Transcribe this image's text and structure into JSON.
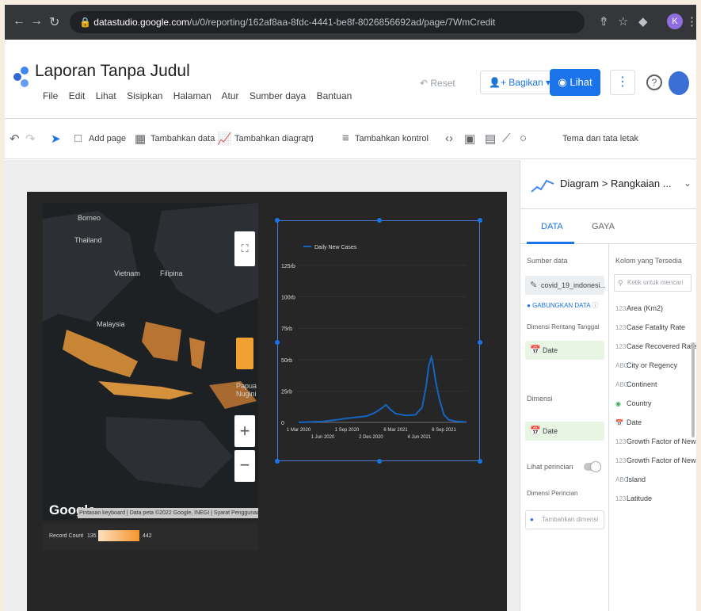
{
  "browser": {
    "url_host": "datastudio.google.com",
    "url_path": "/u/0/reporting/162af8aa-8fdc-4441-be8f-8026856692ad/page/7WmCredit"
  },
  "app": {
    "title": "Laporan Tanpa Judul",
    "menu": [
      "File",
      "Edit",
      "Lihat",
      "Sisipkan",
      "Halaman",
      "Atur",
      "Sumber daya",
      "Bantuan"
    ],
    "reset": "Reset",
    "share": "Bagikan",
    "view": "Lihat"
  },
  "toolbar": {
    "add_page": "Add page",
    "add_data": "Tambahkan data",
    "add_chart": "Tambahkan diagram",
    "add_control": "Tambahkan kontrol",
    "theme": "Tema dan tata letak"
  },
  "map": {
    "labels": [
      "Borneo",
      "Thailand",
      "Vietnam",
      "Filipina",
      "Malaysia",
      "Papua Nugini"
    ],
    "google": "Google",
    "attribution": "Pintasan keyboard | Data peta ©2022 Google, INEGI | Syarat Penggunaan",
    "legend_label": "Record Count",
    "legend_min": "135",
    "legend_max": "442"
  },
  "chart_data": {
    "type": "line",
    "legend": "Daily New Cases",
    "y_ticks": [
      "125rb",
      "100rb",
      "75rb",
      "50rb",
      "25rb",
      "0"
    ],
    "ylim": [
      0,
      125000
    ],
    "x_ticks_top": [
      "1 Mar 2020",
      "1 Sep 2020",
      "6 Mar 2021",
      "6 Sep 2021"
    ],
    "x_ticks_bottom": [
      "1 Jun 2020",
      "2 Des 2020",
      "4 Jun 2021"
    ],
    "series": [
      {
        "name": "Daily New Cases",
        "color": "#1565c0",
        "points": [
          [
            "2020-03-01",
            0
          ],
          [
            "2020-04-15",
            400
          ],
          [
            "2020-06-01",
            700
          ],
          [
            "2020-07-15",
            1800
          ],
          [
            "2020-09-01",
            3200
          ],
          [
            "2020-10-15",
            4200
          ],
          [
            "2020-11-15",
            5000
          ],
          [
            "2020-12-15",
            7500
          ],
          [
            "2021-01-10",
            11000
          ],
          [
            "2021-01-28",
            14000
          ],
          [
            "2021-02-15",
            10000
          ],
          [
            "2021-03-06",
            7000
          ],
          [
            "2021-04-15",
            5500
          ],
          [
            "2021-05-20",
            6000
          ],
          [
            "2021-06-15",
            12000
          ],
          [
            "2021-07-01",
            30000
          ],
          [
            "2021-07-10",
            45000
          ],
          [
            "2021-07-20",
            52000
          ],
          [
            "2021-07-25",
            48000
          ],
          [
            "2021-08-05",
            33000
          ],
          [
            "2021-08-20",
            18000
          ],
          [
            "2021-09-06",
            6000
          ],
          [
            "2021-09-25",
            2000
          ],
          [
            "2021-10-20",
            900
          ],
          [
            "2021-12-01",
            300
          ]
        ]
      }
    ]
  },
  "panel": {
    "title": "Diagram > Rangkaian ...",
    "tab_data": "DATA",
    "tab_style": "GAYA",
    "source_label": "Sumber data",
    "source_value": "covid_19_indonesi...",
    "blend": "GABUNGKAN DATA",
    "date_dim_label": "Dimensi Rentang Tanggal",
    "date_dim_value": "Date",
    "dimension_label": "Dimensi",
    "dimension_value": "Date",
    "drill_label": "Lihat perincian",
    "breakdown_label": "Dimensi Perincian",
    "add_dimension": "Tambahkan dimensi",
    "fields_title": "Kolom yang Tersedia",
    "search_placeholder": "Ketik untuk mencari",
    "fields": [
      "Area (Km2)",
      "Case Fatality Rate",
      "Case Recovered Rate",
      "City or Regency",
      "Continent",
      "Country",
      "Date",
      "Growth Factor of New...",
      "Growth Factor of New...",
      "Island",
      "Latitude"
    ]
  }
}
